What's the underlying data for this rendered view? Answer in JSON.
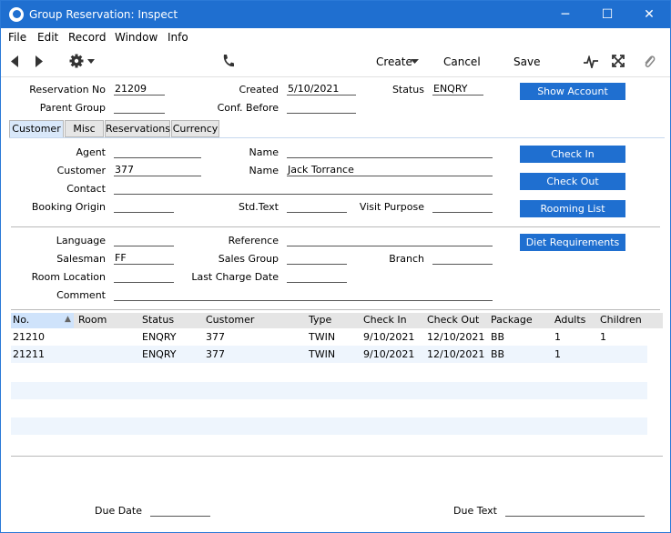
{
  "window": {
    "title": "Group Reservation: Inspect",
    "minimize": "─",
    "maximize": "☐",
    "close": "✕"
  },
  "menu": [
    "File",
    "Edit",
    "Record",
    "Window",
    "Info"
  ],
  "toolbar": {
    "create": "Create",
    "cancel": "Cancel",
    "save": "Save"
  },
  "header": {
    "reservation_no_label": "Reservation No",
    "reservation_no": "21209",
    "created_label": "Created",
    "created": "5/10/2021",
    "status_label": "Status",
    "status": "ENQRY",
    "parent_group_label": "Parent Group",
    "parent_group": "",
    "conf_before_label": "Conf. Before",
    "conf_before": ""
  },
  "buttons": {
    "show_account": "Show Account",
    "check_in": "Check In",
    "check_out": "Check Out",
    "rooming_list": "Rooming List",
    "diet_requirements": "Diet Requirements"
  },
  "tabs": [
    "Customer",
    "Misc",
    "Reservations",
    "Currency"
  ],
  "customer_tab": {
    "agent_label": "Agent",
    "agent": "",
    "agent_name_label": "Name",
    "agent_name": "",
    "customer_label": "Customer",
    "customer": "377",
    "customer_name_label": "Name",
    "customer_name": "Jack Torrance",
    "contact_label": "Contact",
    "contact": "",
    "booking_origin_label": "Booking Origin",
    "booking_origin": "",
    "std_text_label": "Std.Text",
    "std_text": "",
    "visit_purpose_label": "Visit Purpose",
    "visit_purpose": "",
    "language_label": "Language",
    "language": "",
    "reference_label": "Reference",
    "reference": "",
    "salesman_label": "Salesman",
    "salesman": "FF",
    "sales_group_label": "Sales Group",
    "sales_group": "",
    "branch_label": "Branch",
    "branch": "",
    "room_location_label": "Room Location",
    "room_location": "",
    "last_charge_date_label": "Last Charge Date",
    "last_charge_date": "",
    "comment_label": "Comment",
    "comment": ""
  },
  "grid": {
    "columns": [
      "No.",
      "Room",
      "Status",
      "Customer",
      "Type",
      "Check In",
      "Check Out",
      "Package",
      "Adults",
      "Children"
    ],
    "sort_indicator": "▲",
    "rows": [
      {
        "no": "21210",
        "room": "",
        "status": "ENQRY",
        "customer": "377",
        "type": "TWIN",
        "check_in": "9/10/2021",
        "check_out": "12/10/2021",
        "package": "BB",
        "adults": "1",
        "children": "1"
      },
      {
        "no": "21211",
        "room": "",
        "status": "ENQRY",
        "customer": "377",
        "type": "TWIN",
        "check_in": "9/10/2021",
        "check_out": "12/10/2021",
        "package": "BB",
        "adults": "1",
        "children": ""
      }
    ]
  },
  "footer": {
    "due_date_label": "Due Date",
    "due_date": "",
    "due_text_label": "Due Text",
    "due_text": ""
  }
}
